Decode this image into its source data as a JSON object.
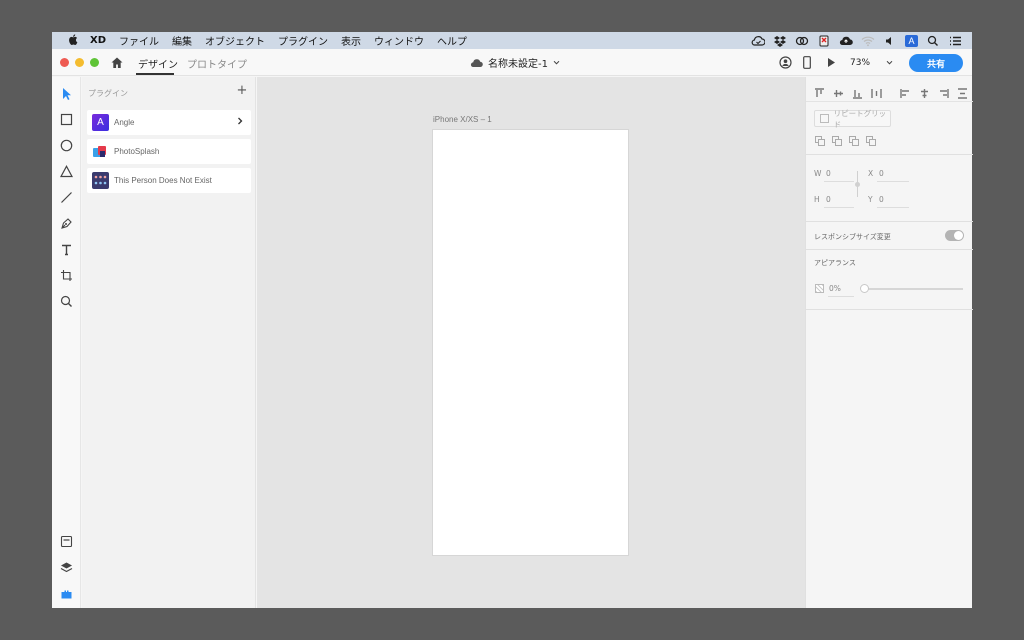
{
  "menubar": {
    "app": "XD",
    "items": [
      "ファイル",
      "編集",
      "オブジェクト",
      "プラグイン",
      "表示",
      "ウィンドウ",
      "ヘルプ"
    ],
    "status_icons": [
      "creative-cloud-sync-icon",
      "dropbox-icon",
      "creative-cloud-icon",
      "notification-icon",
      "cloud-upload-icon",
      "wifi-icon",
      "volume-icon",
      "input-source-icon",
      "spotlight-icon",
      "notification-center-icon"
    ],
    "input_source": "A"
  },
  "titlebar": {
    "tab_design": "デザイン",
    "tab_prototype": "プロトタイプ",
    "doc_title": "名称未設定-1",
    "zoom": "73%",
    "share": "共有"
  },
  "plugins": {
    "header": "プラグイン",
    "add": "+",
    "items": [
      {
        "name": "Angle",
        "icon": "A",
        "color": "#6b2bd9"
      },
      {
        "name": "PhotoSplash",
        "icon": "",
        "color": "#e84a5f"
      },
      {
        "name": "This Person Does Not Exist",
        "icon": "",
        "color": "#3a3a6e"
      }
    ]
  },
  "canvas": {
    "artboard_label": "iPhone X/XS – 1"
  },
  "properties": {
    "repeat_grid": "リピートグリッド",
    "w_label": "W",
    "w_value": "0",
    "h_label": "H",
    "h_value": "0",
    "x_label": "X",
    "x_value": "0",
    "y_label": "Y",
    "y_value": "0",
    "responsive_resize": "レスポンシブサイズ変更",
    "appearance": "アピアランス",
    "opacity": "0%"
  },
  "colors": {
    "accent": "#2a8bf2",
    "select_tool": "#2a8bf2"
  }
}
